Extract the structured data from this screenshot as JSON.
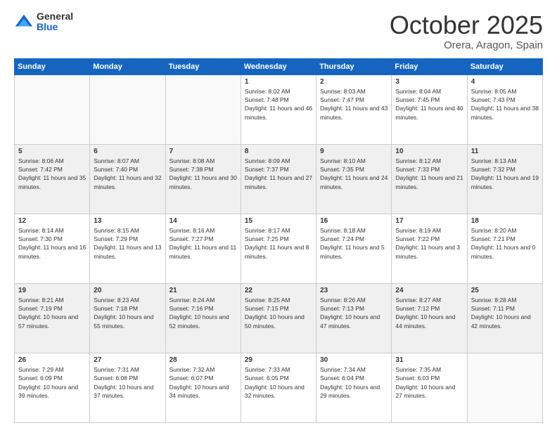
{
  "logo": {
    "general": "General",
    "blue": "Blue"
  },
  "title": "October 2025",
  "location": "Orera, Aragon, Spain",
  "days_of_week": [
    "Sunday",
    "Monday",
    "Tuesday",
    "Wednesday",
    "Thursday",
    "Friday",
    "Saturday"
  ],
  "weeks": [
    [
      {
        "day": "",
        "sunrise": "",
        "sunset": "",
        "daylight": "",
        "empty": true
      },
      {
        "day": "",
        "sunrise": "",
        "sunset": "",
        "daylight": "",
        "empty": true
      },
      {
        "day": "",
        "sunrise": "",
        "sunset": "",
        "daylight": "",
        "empty": true
      },
      {
        "day": "1",
        "sunrise": "Sunrise: 8:02 AM",
        "sunset": "Sunset: 7:48 PM",
        "daylight": "Daylight: 11 hours and 46 minutes.",
        "empty": false
      },
      {
        "day": "2",
        "sunrise": "Sunrise: 8:03 AM",
        "sunset": "Sunset: 7:47 PM",
        "daylight": "Daylight: 11 hours and 43 minutes.",
        "empty": false
      },
      {
        "day": "3",
        "sunrise": "Sunrise: 8:04 AM",
        "sunset": "Sunset: 7:45 PM",
        "daylight": "Daylight: 11 hours and 40 minutes.",
        "empty": false
      },
      {
        "day": "4",
        "sunrise": "Sunrise: 8:05 AM",
        "sunset": "Sunset: 7:43 PM",
        "daylight": "Daylight: 11 hours and 38 minutes.",
        "empty": false
      }
    ],
    [
      {
        "day": "5",
        "sunrise": "Sunrise: 8:06 AM",
        "sunset": "Sunset: 7:42 PM",
        "daylight": "Daylight: 11 hours and 35 minutes.",
        "empty": false
      },
      {
        "day": "6",
        "sunrise": "Sunrise: 8:07 AM",
        "sunset": "Sunset: 7:40 PM",
        "daylight": "Daylight: 11 hours and 32 minutes.",
        "empty": false
      },
      {
        "day": "7",
        "sunrise": "Sunrise: 8:08 AM",
        "sunset": "Sunset: 7:38 PM",
        "daylight": "Daylight: 11 hours and 30 minutes.",
        "empty": false
      },
      {
        "day": "8",
        "sunrise": "Sunrise: 8:09 AM",
        "sunset": "Sunset: 7:37 PM",
        "daylight": "Daylight: 11 hours and 27 minutes.",
        "empty": false
      },
      {
        "day": "9",
        "sunrise": "Sunrise: 8:10 AM",
        "sunset": "Sunset: 7:35 PM",
        "daylight": "Daylight: 11 hours and 24 minutes.",
        "empty": false
      },
      {
        "day": "10",
        "sunrise": "Sunrise: 8:12 AM",
        "sunset": "Sunset: 7:33 PM",
        "daylight": "Daylight: 11 hours and 21 minutes.",
        "empty": false
      },
      {
        "day": "11",
        "sunrise": "Sunrise: 8:13 AM",
        "sunset": "Sunset: 7:32 PM",
        "daylight": "Daylight: 11 hours and 19 minutes.",
        "empty": false
      }
    ],
    [
      {
        "day": "12",
        "sunrise": "Sunrise: 8:14 AM",
        "sunset": "Sunset: 7:30 PM",
        "daylight": "Daylight: 11 hours and 16 minutes.",
        "empty": false
      },
      {
        "day": "13",
        "sunrise": "Sunrise: 8:15 AM",
        "sunset": "Sunset: 7:29 PM",
        "daylight": "Daylight: 11 hours and 13 minutes.",
        "empty": false
      },
      {
        "day": "14",
        "sunrise": "Sunrise: 8:16 AM",
        "sunset": "Sunset: 7:27 PM",
        "daylight": "Daylight: 11 hours and 11 minutes.",
        "empty": false
      },
      {
        "day": "15",
        "sunrise": "Sunrise: 8:17 AM",
        "sunset": "Sunset: 7:25 PM",
        "daylight": "Daylight: 11 hours and 8 minutes.",
        "empty": false
      },
      {
        "day": "16",
        "sunrise": "Sunrise: 8:18 AM",
        "sunset": "Sunset: 7:24 PM",
        "daylight": "Daylight: 11 hours and 5 minutes.",
        "empty": false
      },
      {
        "day": "17",
        "sunrise": "Sunrise: 8:19 AM",
        "sunset": "Sunset: 7:22 PM",
        "daylight": "Daylight: 11 hours and 3 minutes.",
        "empty": false
      },
      {
        "day": "18",
        "sunrise": "Sunrise: 8:20 AM",
        "sunset": "Sunset: 7:21 PM",
        "daylight": "Daylight: 11 hours and 0 minutes.",
        "empty": false
      }
    ],
    [
      {
        "day": "19",
        "sunrise": "Sunrise: 8:21 AM",
        "sunset": "Sunset: 7:19 PM",
        "daylight": "Daylight: 10 hours and 57 minutes.",
        "empty": false
      },
      {
        "day": "20",
        "sunrise": "Sunrise: 8:23 AM",
        "sunset": "Sunset: 7:18 PM",
        "daylight": "Daylight: 10 hours and 55 minutes.",
        "empty": false
      },
      {
        "day": "21",
        "sunrise": "Sunrise: 8:24 AM",
        "sunset": "Sunset: 7:16 PM",
        "daylight": "Daylight: 10 hours and 52 minutes.",
        "empty": false
      },
      {
        "day": "22",
        "sunrise": "Sunrise: 8:25 AM",
        "sunset": "Sunset: 7:15 PM",
        "daylight": "Daylight: 10 hours and 50 minutes.",
        "empty": false
      },
      {
        "day": "23",
        "sunrise": "Sunrise: 8:26 AM",
        "sunset": "Sunset: 7:13 PM",
        "daylight": "Daylight: 10 hours and 47 minutes.",
        "empty": false
      },
      {
        "day": "24",
        "sunrise": "Sunrise: 8:27 AM",
        "sunset": "Sunset: 7:12 PM",
        "daylight": "Daylight: 10 hours and 44 minutes.",
        "empty": false
      },
      {
        "day": "25",
        "sunrise": "Sunrise: 8:28 AM",
        "sunset": "Sunset: 7:11 PM",
        "daylight": "Daylight: 10 hours and 42 minutes.",
        "empty": false
      }
    ],
    [
      {
        "day": "26",
        "sunrise": "Sunrise: 7:29 AM",
        "sunset": "Sunset: 6:09 PM",
        "daylight": "Daylight: 10 hours and 39 minutes.",
        "empty": false
      },
      {
        "day": "27",
        "sunrise": "Sunrise: 7:31 AM",
        "sunset": "Sunset: 6:08 PM",
        "daylight": "Daylight: 10 hours and 37 minutes.",
        "empty": false
      },
      {
        "day": "28",
        "sunrise": "Sunrise: 7:32 AM",
        "sunset": "Sunset: 6:07 PM",
        "daylight": "Daylight: 10 hours and 34 minutes.",
        "empty": false
      },
      {
        "day": "29",
        "sunrise": "Sunrise: 7:33 AM",
        "sunset": "Sunset: 6:05 PM",
        "daylight": "Daylight: 10 hours and 32 minutes.",
        "empty": false
      },
      {
        "day": "30",
        "sunrise": "Sunrise: 7:34 AM",
        "sunset": "Sunset: 6:04 PM",
        "daylight": "Daylight: 10 hours and 29 minutes.",
        "empty": false
      },
      {
        "day": "31",
        "sunrise": "Sunrise: 7:35 AM",
        "sunset": "Sunset: 6:03 PM",
        "daylight": "Daylight: 10 hours and 27 minutes.",
        "empty": false
      },
      {
        "day": "",
        "sunrise": "",
        "sunset": "",
        "daylight": "",
        "empty": true
      }
    ]
  ]
}
